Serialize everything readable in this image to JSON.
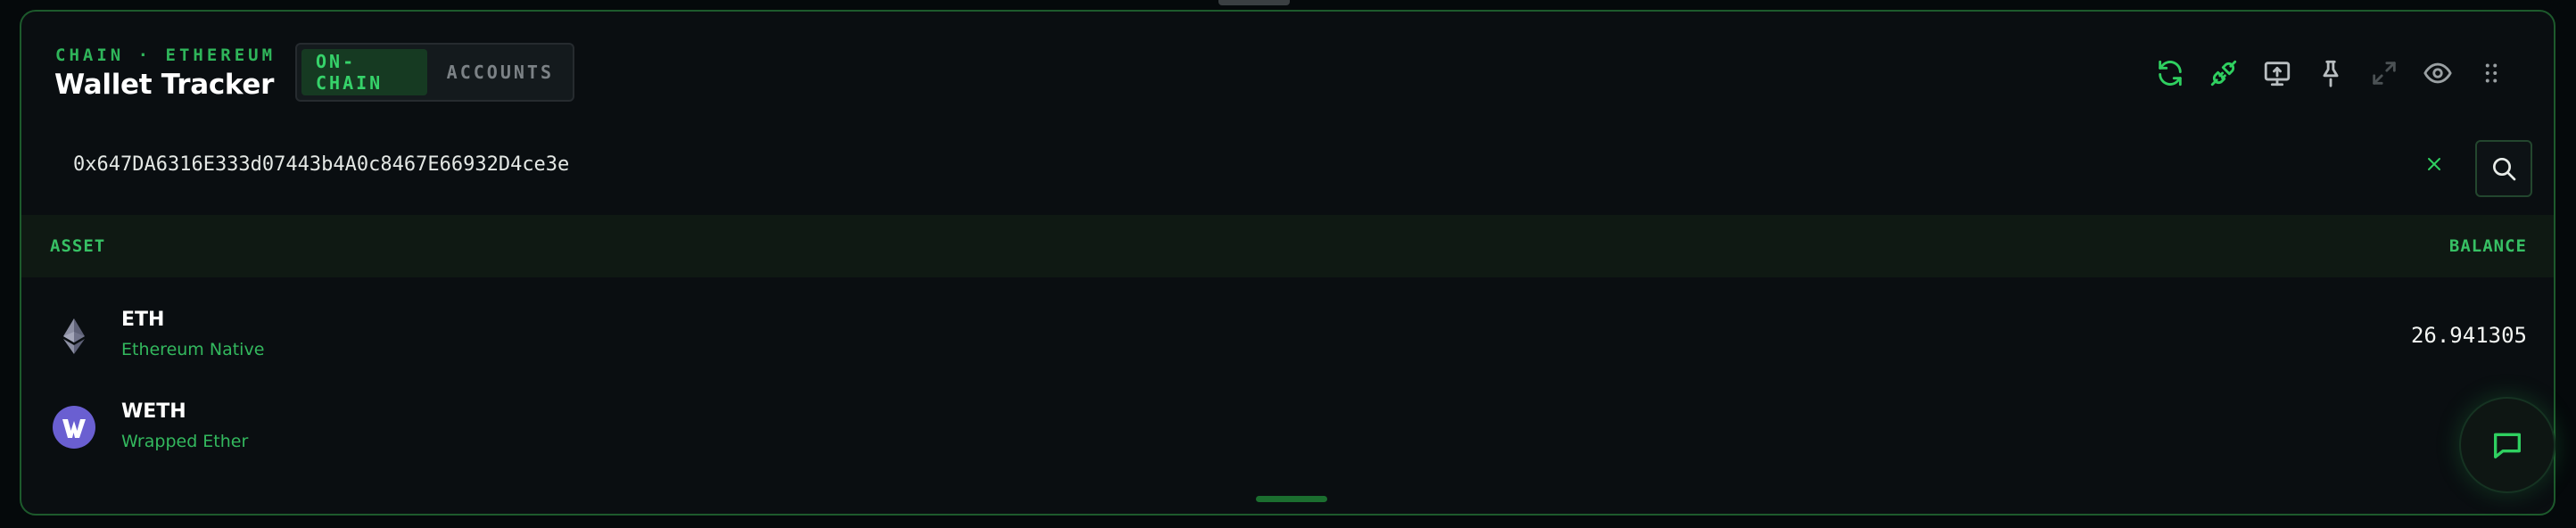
{
  "header": {
    "chain_label": "CHAIN · ETHEREUM",
    "title": "Wallet Tracker",
    "tabs": [
      {
        "label": "ON-CHAIN",
        "active": true
      },
      {
        "label": "ACCOUNTS",
        "active": false
      }
    ]
  },
  "toolbar": {
    "icons": [
      "refresh-icon",
      "plug-icon",
      "monitor-upload-icon",
      "pin-icon",
      "expand-icon",
      "eye-icon",
      "drag-grip-icon"
    ]
  },
  "search": {
    "value": "0x647DA6316E333d07443b4A0c8467E66932D4ce3e",
    "placeholder": ""
  },
  "table": {
    "columns": {
      "asset": "ASSET",
      "balance": "BALANCE"
    },
    "rows": [
      {
        "symbol": "ETH",
        "name": "Ethereum Native",
        "balance": "26.941305",
        "icon": "ethereum-icon"
      },
      {
        "symbol": "WETH",
        "name": "Wrapped Ether",
        "balance": "",
        "icon": "weth-icon"
      }
    ]
  },
  "colors": {
    "accent": "#36d36a",
    "accent_dim": "#2fb55a",
    "background": "#0a0e11",
    "border": "#1d5a2c",
    "weth_purple": "#6a5fd1"
  }
}
